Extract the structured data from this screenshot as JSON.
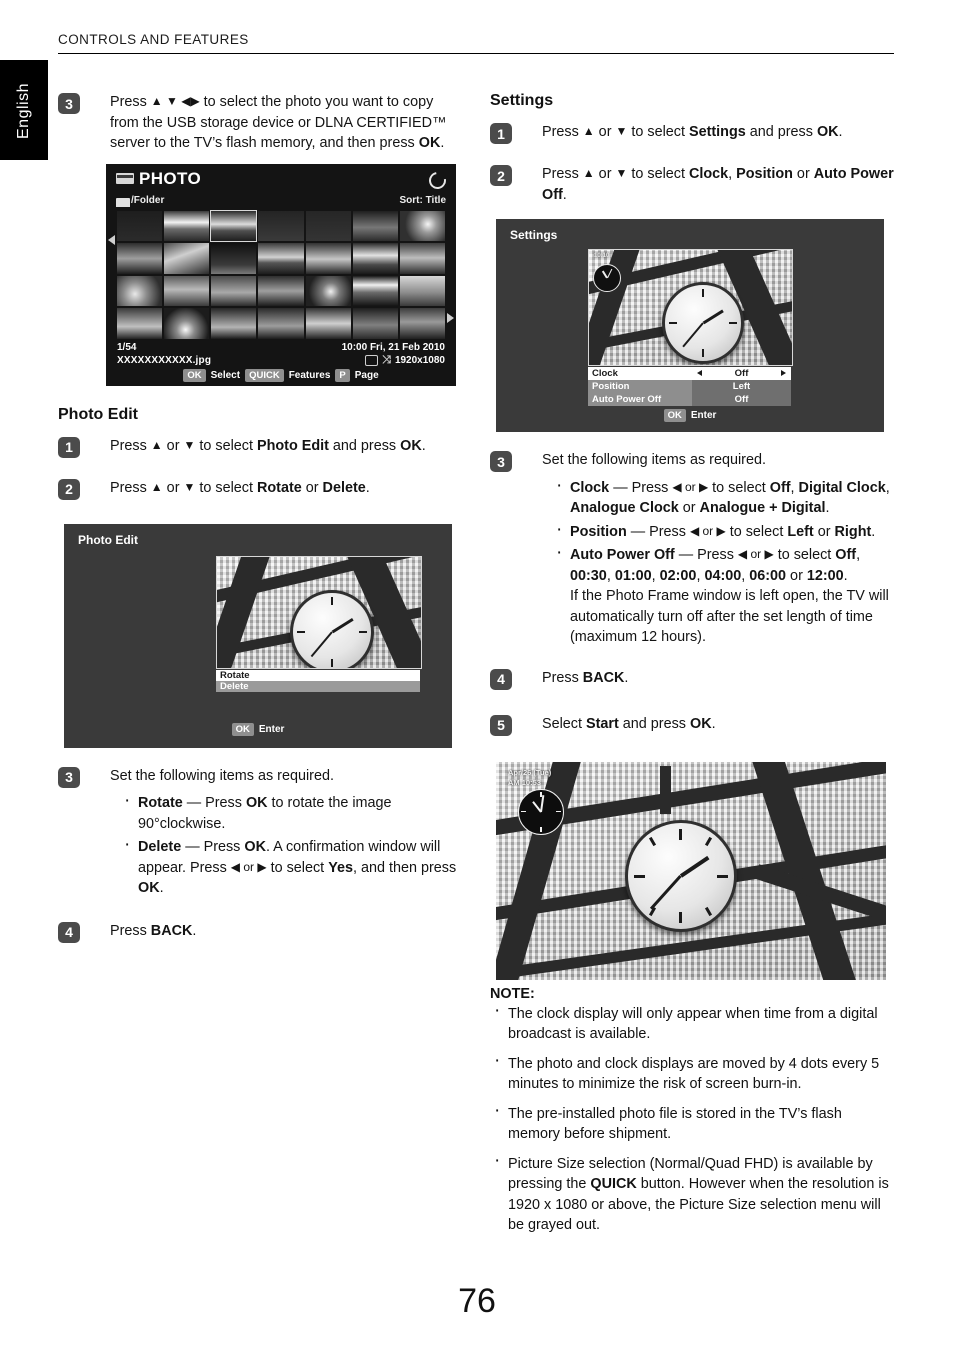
{
  "header": {
    "running_head": "CONTROLS AND FEATURES",
    "language_tab": "English"
  },
  "page_number": "76",
  "left_column": {
    "step3": {
      "badge": "3",
      "text_part1": "Press ",
      "arrows": "▲ ▼ ◀▶",
      "text_part2": " to select the photo you want to copy from the USB storage device or DLNA CERTIFIED™ server to the TV’s flash memory, and then press ",
      "bold_ok": "OK",
      "text_end": "."
    },
    "photo_screen": {
      "title": "PHOTO",
      "logo_icon": "photo-logo-icon",
      "refresh_icon": "refresh-icon",
      "folder_icon": "folder-icon",
      "breadcrumb": "/Folder",
      "sort": "Sort: Title",
      "left_arrow_icon": "left-arrow-icon",
      "right_arrow_icon": "right-arrow-icon",
      "count": "1/54",
      "filename": "XXXXXXXXXXX.jpg",
      "datetime": "10:00 Fri, 21 Feb 2010",
      "loop_icon": "loop-icon",
      "shuffle_icon": "shuffle-icon",
      "resolution": "1920x1080",
      "legend": [
        {
          "key": "OK",
          "label": "Select"
        },
        {
          "key": "QUICK",
          "label": "Features"
        },
        {
          "key": "P",
          "label": "Page"
        }
      ],
      "grid_columns": 7,
      "grid_rows": 4,
      "selected_thumb_index": 2
    },
    "photo_edit": {
      "section_title": "Photo Edit",
      "step1": {
        "badge": "1",
        "pre": "Press ",
        "arrow_up": "▲",
        "mid": " or ",
        "arrow_down": "▼",
        "text": " to select ",
        "bold1": "Photo Edit",
        "tail": " and press ",
        "bold2": "OK",
        "end": "."
      },
      "step2": {
        "badge": "2",
        "pre": "Press ",
        "arrow_up": "▲",
        "mid": " or ",
        "arrow_down": "▼",
        "text": " to select ",
        "bold1": "Rotate",
        "tail": " or ",
        "bold2": "Delete",
        "end": "."
      },
      "dialog": {
        "title": "Photo Edit",
        "rows": [
          {
            "label": "Rotate",
            "state": "normal"
          },
          {
            "label": "Delete",
            "state": "selected"
          }
        ],
        "footer_key": "OK",
        "footer_label": "Enter"
      },
      "step3": {
        "badge": "3",
        "intro": "Set the following items as required.",
        "bullets": [
          {
            "bold": "Rotate",
            "text": " — Press ",
            "bold2": "OK",
            "text2": " to rotate the image 90°clockwise."
          },
          {
            "bold": "Delete",
            "text": " — Press ",
            "bold2": "OK",
            "text2": ". A confirmation window will appear. Press ",
            "arrows": "◀ or ▶",
            "text3": " to select ",
            "bold3": "Yes",
            "text4": ", and then press ",
            "bold4": "OK",
            "text5": "."
          }
        ]
      },
      "step4": {
        "badge": "4",
        "pre": "Press ",
        "bold": "BACK",
        "end": "."
      }
    }
  },
  "right_column": {
    "section_title": "Settings",
    "step1": {
      "badge": "1",
      "pre": "Press ",
      "arrow_up": "▲",
      "mid": " or ",
      "arrow_down": "▼",
      "text": " to select ",
      "bold1": "Settings",
      "tail": " and press ",
      "bold2": "OK",
      "end": "."
    },
    "step2": {
      "badge": "2",
      "pre": "Press ",
      "arrow_up": "▲",
      "mid": " or ",
      "arrow_down": "▼",
      "text": " to select ",
      "bold1": "Clock",
      "sep1": ", ",
      "bold2": "Position",
      "sep2": " or ",
      "bold3": "Auto Power Off",
      "end": "."
    },
    "settings_dialog": {
      "title": "Settings",
      "preview_overlay_time": "10:10",
      "rows": [
        {
          "label": "Clock",
          "value": "Off",
          "state": "selected",
          "left_arrow": "◀",
          "right_arrow": "▶"
        },
        {
          "label": "Position",
          "value": "Left",
          "state": "normal"
        },
        {
          "label": "Auto Power Off",
          "value": "Off",
          "state": "normal"
        }
      ],
      "footer_key": "OK",
      "footer_label": "Enter"
    },
    "step3": {
      "badge": "3",
      "intro": "Set the following items as required.",
      "bullets": [
        {
          "bold": "Clock",
          "t1": " — Press ",
          "arrows": "◀ or ▶",
          "t2": " to select ",
          "b1": "Off",
          "t3": ", ",
          "b2": "Digital Clock",
          "t4": ", ",
          "b3": "Analogue Clock",
          "t5": " or ",
          "b4": "Analogue + Digital",
          "t6": "."
        },
        {
          "bold": "Position",
          "t1": " — Press ",
          "arrows": "◀ or ▶",
          "t2": " to select ",
          "b1": "Left",
          "t3": " or ",
          "b2": "Right",
          "t4": "."
        },
        {
          "bold": "Auto Power Off",
          "t1": " — Press ",
          "arrows": "◀ or ▶",
          "t2": " to select ",
          "b1": "Off",
          "t3": ", ",
          "b2": "00:30",
          "t4": ", ",
          "b3": "01:00",
          "t5": ", ",
          "b4": "02:00",
          "t6": ", ",
          "b5": "04:00",
          "t7": ", ",
          "b6": "06:00",
          "t8": " or ",
          "b7": "12:00",
          "t9": ".",
          "continuation": "If the Photo Frame window is left open, the TV will automatically turn off after the set length of time (maximum 12 hours)."
        }
      ]
    },
    "step4": {
      "badge": "4",
      "pre": "Press ",
      "bold": "BACK",
      "end": "."
    },
    "step5": {
      "badge": "5",
      "pre": "Select ",
      "bold1": "Start",
      "mid": " and press ",
      "bold2": "OK",
      "end": "."
    },
    "frame_screen": {
      "overlay_date": "Apr/26 (Tue)",
      "overlay_time": "AM 10:53",
      "clock_icon": "analogue-clock-icon"
    },
    "note": {
      "title": "NOTE:",
      "items": [
        "The clock display will only appear when time from a digital broadcast is available.",
        "The photo and clock displays are moved by 4 dots every 5 minutes to minimize the risk of screen burn-in.",
        "The pre-installed photo file is stored in the TV’s flash memory before shipment."
      ],
      "last_item": {
        "p1": "Picture Size selection (Normal/Quad FHD) is available by pressing the ",
        "bold": "QUICK",
        "p2": " button. However when the resolution is 1920 x 1080 or above, the Picture Size selection menu will be grayed out."
      }
    }
  },
  "colors": {
    "badge_bg": "#4b4b4b",
    "dialog_bg": "#3a3a3a",
    "screen_bg": "#141414",
    "selected_row": "#9a9a9a",
    "key_bg": "#8f8f8f"
  }
}
